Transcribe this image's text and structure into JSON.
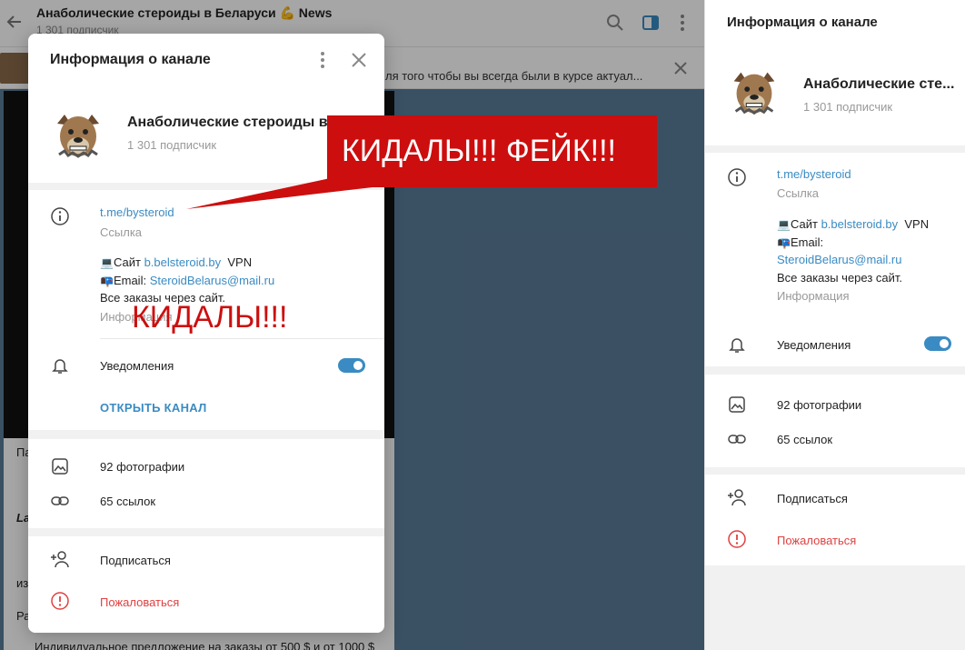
{
  "chat": {
    "title": "Анаболические стероиды в Беларуси 💪 News",
    "subscribers": "1 301 подписчик",
    "pinned_text": "ля того чтобы вы всегда были в курсе актуал...",
    "bubble_lines": [
      "Па",
      "",
      "",
      "La",
      "",
      "из",
      "",
      "Ра",
      "Индивидуальное предложение на заказы от 500 $ и от 1000 $"
    ]
  },
  "right_panel": {
    "title": "Информация о канале",
    "channel_name": "Анаболические сте...",
    "subscribers": "1 301 подписчик",
    "link": "t.me/bysteroid",
    "link_caption": "Ссылка",
    "site_prefix": "Сайт",
    "site_link": "b.belsteroid.by",
    "site_suffix": "VPN",
    "email_prefix": "Email:",
    "email_link": "SteroidBelarus@mail.ru",
    "orders": "Все заказы через сайт.",
    "info_caption": "Информация",
    "notifications": "Уведомления",
    "photos": "92 фотографии",
    "links": "65 ссылок",
    "subscribe": "Подписаться",
    "report": "Пожаловаться"
  },
  "modal": {
    "title": "Информация о канале",
    "channel_name": "Анаболические стероиды в Бе...",
    "subscribers": "1 301 подписчик",
    "link": "t.me/bysteroid",
    "link_caption": "Ссылка",
    "site_prefix": "Сайт",
    "site_link": "b.belsteroid.by",
    "site_suffix": "VPN",
    "email_prefix": "Email:",
    "email_link": "SteroidBelarus@mail.ru",
    "orders": "Все заказы через сайт.",
    "info_caption": "Информация",
    "notifications": "Уведомления",
    "open_channel": "ОТКРЫТЬ КАНАЛ",
    "photos": "92 фотографии",
    "links": "65 ссылок",
    "subscribe": "Подписаться",
    "report": "Пожаловаться"
  },
  "overlays": {
    "callout": "КИДАЛЫ!!! ФЕЙК!!!",
    "scam": "КИДАЛЫ!!!"
  },
  "colors": {
    "accent": "#3a8bc3",
    "danger": "#e04040",
    "warning_red": "#cc0e0e"
  },
  "icons": {
    "info": "info-icon",
    "bell": "bell-icon",
    "photo": "photo-icon",
    "link": "link-icon",
    "add_user": "add-user-icon",
    "report": "report-icon",
    "close": "close-icon",
    "more": "more-vertical-icon",
    "search": "search-icon",
    "sidebar": "sidebar-toggle-icon",
    "back": "back-arrow-icon",
    "computer": "computer-icon",
    "mailbox": "mailbox-icon"
  }
}
